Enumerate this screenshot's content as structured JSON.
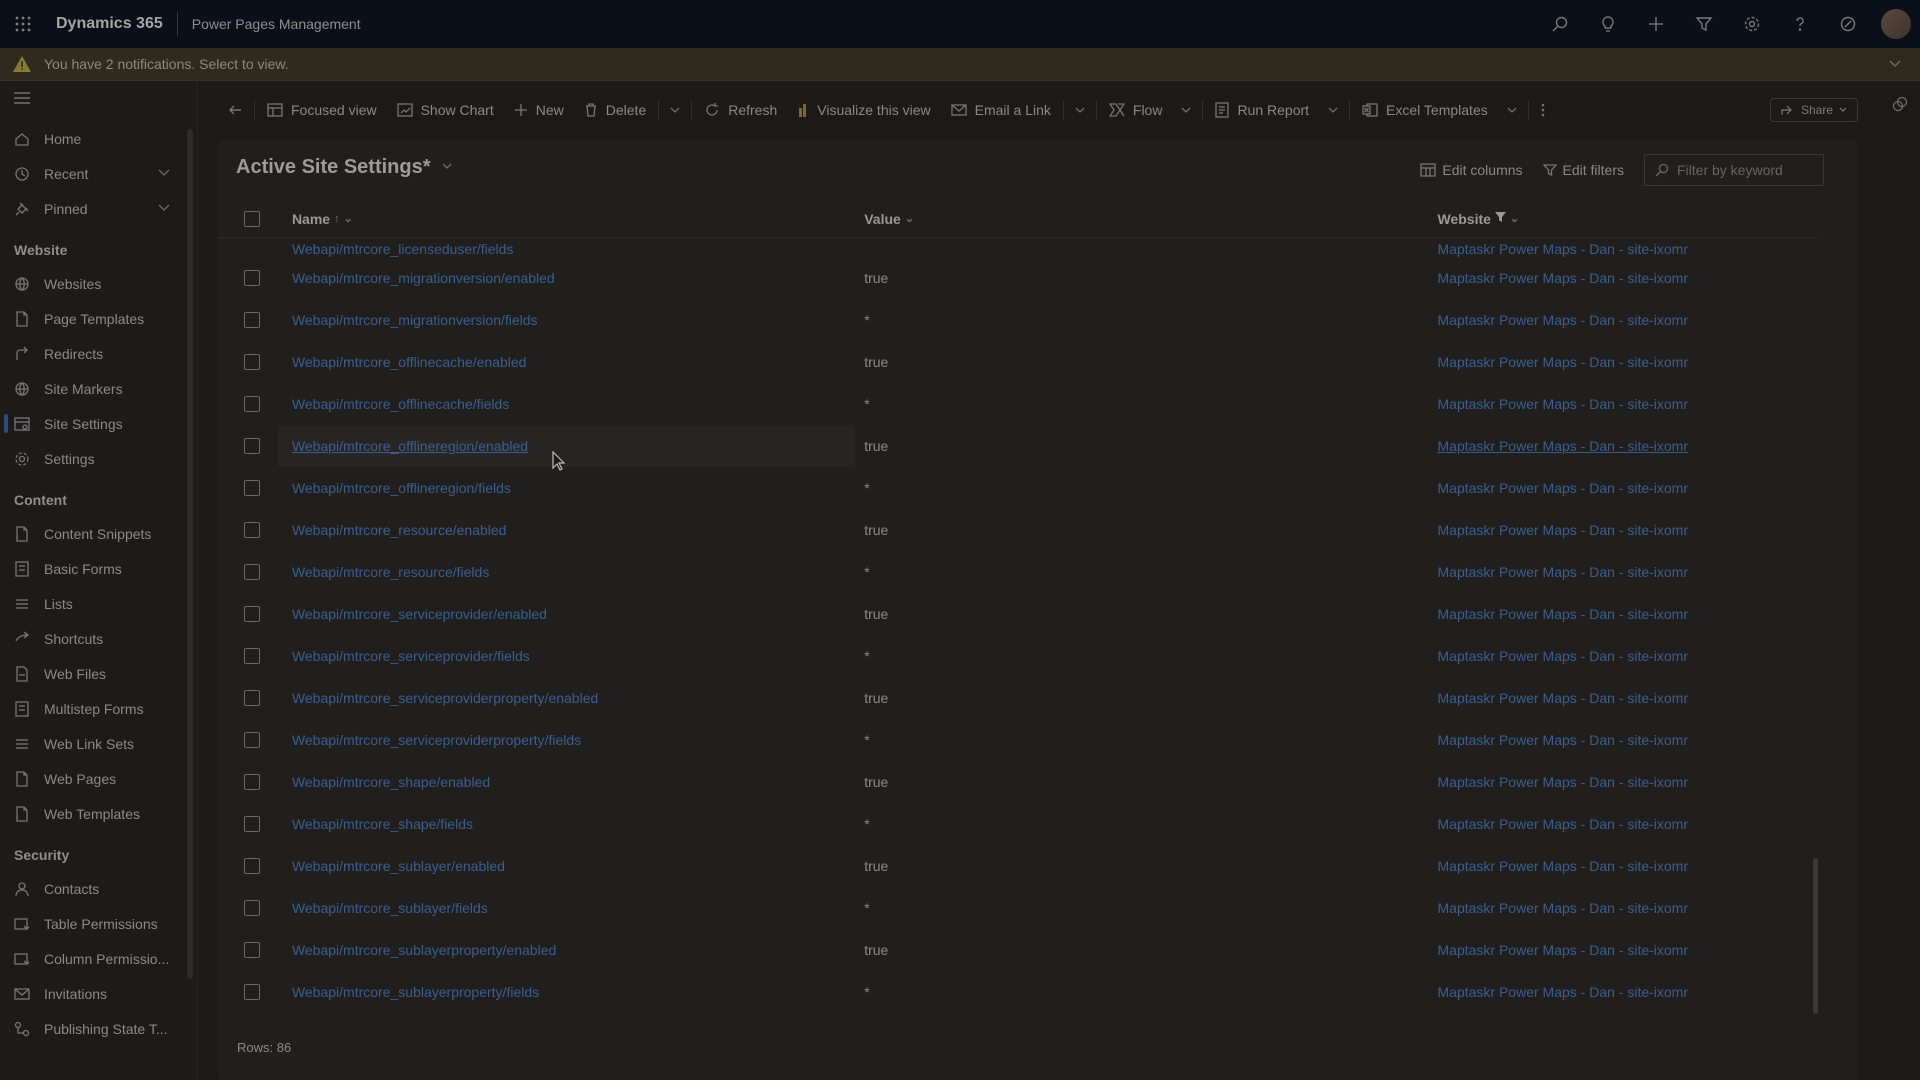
{
  "topbar": {
    "brand": "Dynamics 365",
    "app_name": "Power Pages Management",
    "icons": [
      "search-icon",
      "lightbulb-icon",
      "plus-icon",
      "filter-icon",
      "gear-icon",
      "help-icon",
      "copilot-icon",
      "avatar"
    ]
  },
  "notification": {
    "text": "You have 2 notifications. Select to view."
  },
  "sidebar": {
    "top_items": [
      {
        "label": "Home",
        "icon": "home-icon"
      },
      {
        "label": "Recent",
        "icon": "clock-icon"
      },
      {
        "label": "Pinned",
        "icon": "pin-icon"
      }
    ],
    "groups": [
      {
        "title": "Website",
        "items": [
          {
            "label": "Websites",
            "icon": "globe-icon"
          },
          {
            "label": "Page Templates",
            "icon": "page-icon"
          },
          {
            "label": "Redirects",
            "icon": "redirect-icon"
          },
          {
            "label": "Site Markers",
            "icon": "globe-icon"
          },
          {
            "label": "Site Settings",
            "icon": "settings-table-icon",
            "active": true
          },
          {
            "label": "Settings",
            "icon": "gear-icon"
          }
        ]
      },
      {
        "title": "Content",
        "items": [
          {
            "label": "Content Snippets",
            "icon": "page-icon"
          },
          {
            "label": "Basic Forms",
            "icon": "form-icon"
          },
          {
            "label": "Lists",
            "icon": "list-icon"
          },
          {
            "label": "Shortcuts",
            "icon": "shortcut-icon"
          },
          {
            "label": "Web Files",
            "icon": "file-icon"
          },
          {
            "label": "Multistep Forms",
            "icon": "form-icon"
          },
          {
            "label": "Web Link Sets",
            "icon": "list-icon"
          },
          {
            "label": "Web Pages",
            "icon": "page-icon"
          },
          {
            "label": "Web Templates",
            "icon": "page-icon"
          }
        ]
      },
      {
        "title": "Security",
        "items": [
          {
            "label": "Contacts",
            "icon": "person-icon"
          },
          {
            "label": "Table Permissions",
            "icon": "permission-icon"
          },
          {
            "label": "Column Permissio...",
            "icon": "permission-icon"
          },
          {
            "label": "Invitations",
            "icon": "invitation-icon"
          },
          {
            "label": "Publishing State T...",
            "icon": "state-icon"
          }
        ]
      }
    ]
  },
  "commandbar": {
    "focused_view": "Focused view",
    "show_chart": "Show Chart",
    "new": "New",
    "delete": "Delete",
    "refresh": "Refresh",
    "visualize": "Visualize this view",
    "email_link": "Email a Link",
    "flow": "Flow",
    "run_report": "Run Report",
    "excel_templates": "Excel Templates",
    "share": "Share"
  },
  "view": {
    "title": "Active Site Settings*",
    "edit_columns": "Edit columns",
    "edit_filters": "Edit filters",
    "filter_placeholder": "Filter by keyword"
  },
  "grid": {
    "columns": {
      "name": "Name",
      "value": "Value",
      "website": "Website"
    },
    "partial_row": {
      "name": "Webapi/mtrcore_licenseduser/fields",
      "value": "",
      "website": "Maptaskr Power Maps - Dan - site-ixomr"
    },
    "rows": [
      {
        "name": "Webapi/mtrcore_migrationversion/enabled",
        "value": "true",
        "website": "Maptaskr Power Maps - Dan - site-ixomr"
      },
      {
        "name": "Webapi/mtrcore_migrationversion/fields",
        "value": "*",
        "website": "Maptaskr Power Maps - Dan - site-ixomr"
      },
      {
        "name": "Webapi/mtrcore_offlinecache/enabled",
        "value": "true",
        "website": "Maptaskr Power Maps - Dan - site-ixomr"
      },
      {
        "name": "Webapi/mtrcore_offlinecache/fields",
        "value": "*",
        "website": "Maptaskr Power Maps - Dan - site-ixomr"
      },
      {
        "name": "Webapi/mtrcore_offlineregion/enabled",
        "value": "true",
        "website": "Maptaskr Power Maps - Dan - site-ixomr",
        "hover": true
      },
      {
        "name": "Webapi/mtrcore_offlineregion/fields",
        "value": "*",
        "website": "Maptaskr Power Maps - Dan - site-ixomr"
      },
      {
        "name": "Webapi/mtrcore_resource/enabled",
        "value": "true",
        "website": "Maptaskr Power Maps - Dan - site-ixomr"
      },
      {
        "name": "Webapi/mtrcore_resource/fields",
        "value": "*",
        "website": "Maptaskr Power Maps - Dan - site-ixomr"
      },
      {
        "name": "Webapi/mtrcore_serviceprovider/enabled",
        "value": "true",
        "website": "Maptaskr Power Maps - Dan - site-ixomr"
      },
      {
        "name": "Webapi/mtrcore_serviceprovider/fields",
        "value": "*",
        "website": "Maptaskr Power Maps - Dan - site-ixomr"
      },
      {
        "name": "Webapi/mtrcore_serviceproviderproperty/enabled",
        "value": "true",
        "website": "Maptaskr Power Maps - Dan - site-ixomr"
      },
      {
        "name": "Webapi/mtrcore_serviceproviderproperty/fields",
        "value": "*",
        "website": "Maptaskr Power Maps - Dan - site-ixomr"
      },
      {
        "name": "Webapi/mtrcore_shape/enabled",
        "value": "true",
        "website": "Maptaskr Power Maps - Dan - site-ixomr"
      },
      {
        "name": "Webapi/mtrcore_shape/fields",
        "value": "*",
        "website": "Maptaskr Power Maps - Dan - site-ixomr"
      },
      {
        "name": "Webapi/mtrcore_sublayer/enabled",
        "value": "true",
        "website": "Maptaskr Power Maps - Dan - site-ixomr"
      },
      {
        "name": "Webapi/mtrcore_sublayer/fields",
        "value": "*",
        "website": "Maptaskr Power Maps - Dan - site-ixomr"
      },
      {
        "name": "Webapi/mtrcore_sublayerproperty/enabled",
        "value": "true",
        "website": "Maptaskr Power Maps - Dan - site-ixomr"
      },
      {
        "name": "Webapi/mtrcore_sublayerproperty/fields",
        "value": "*",
        "website": "Maptaskr Power Maps - Dan - site-ixomr"
      }
    ],
    "rows_count": "Rows: 86"
  }
}
